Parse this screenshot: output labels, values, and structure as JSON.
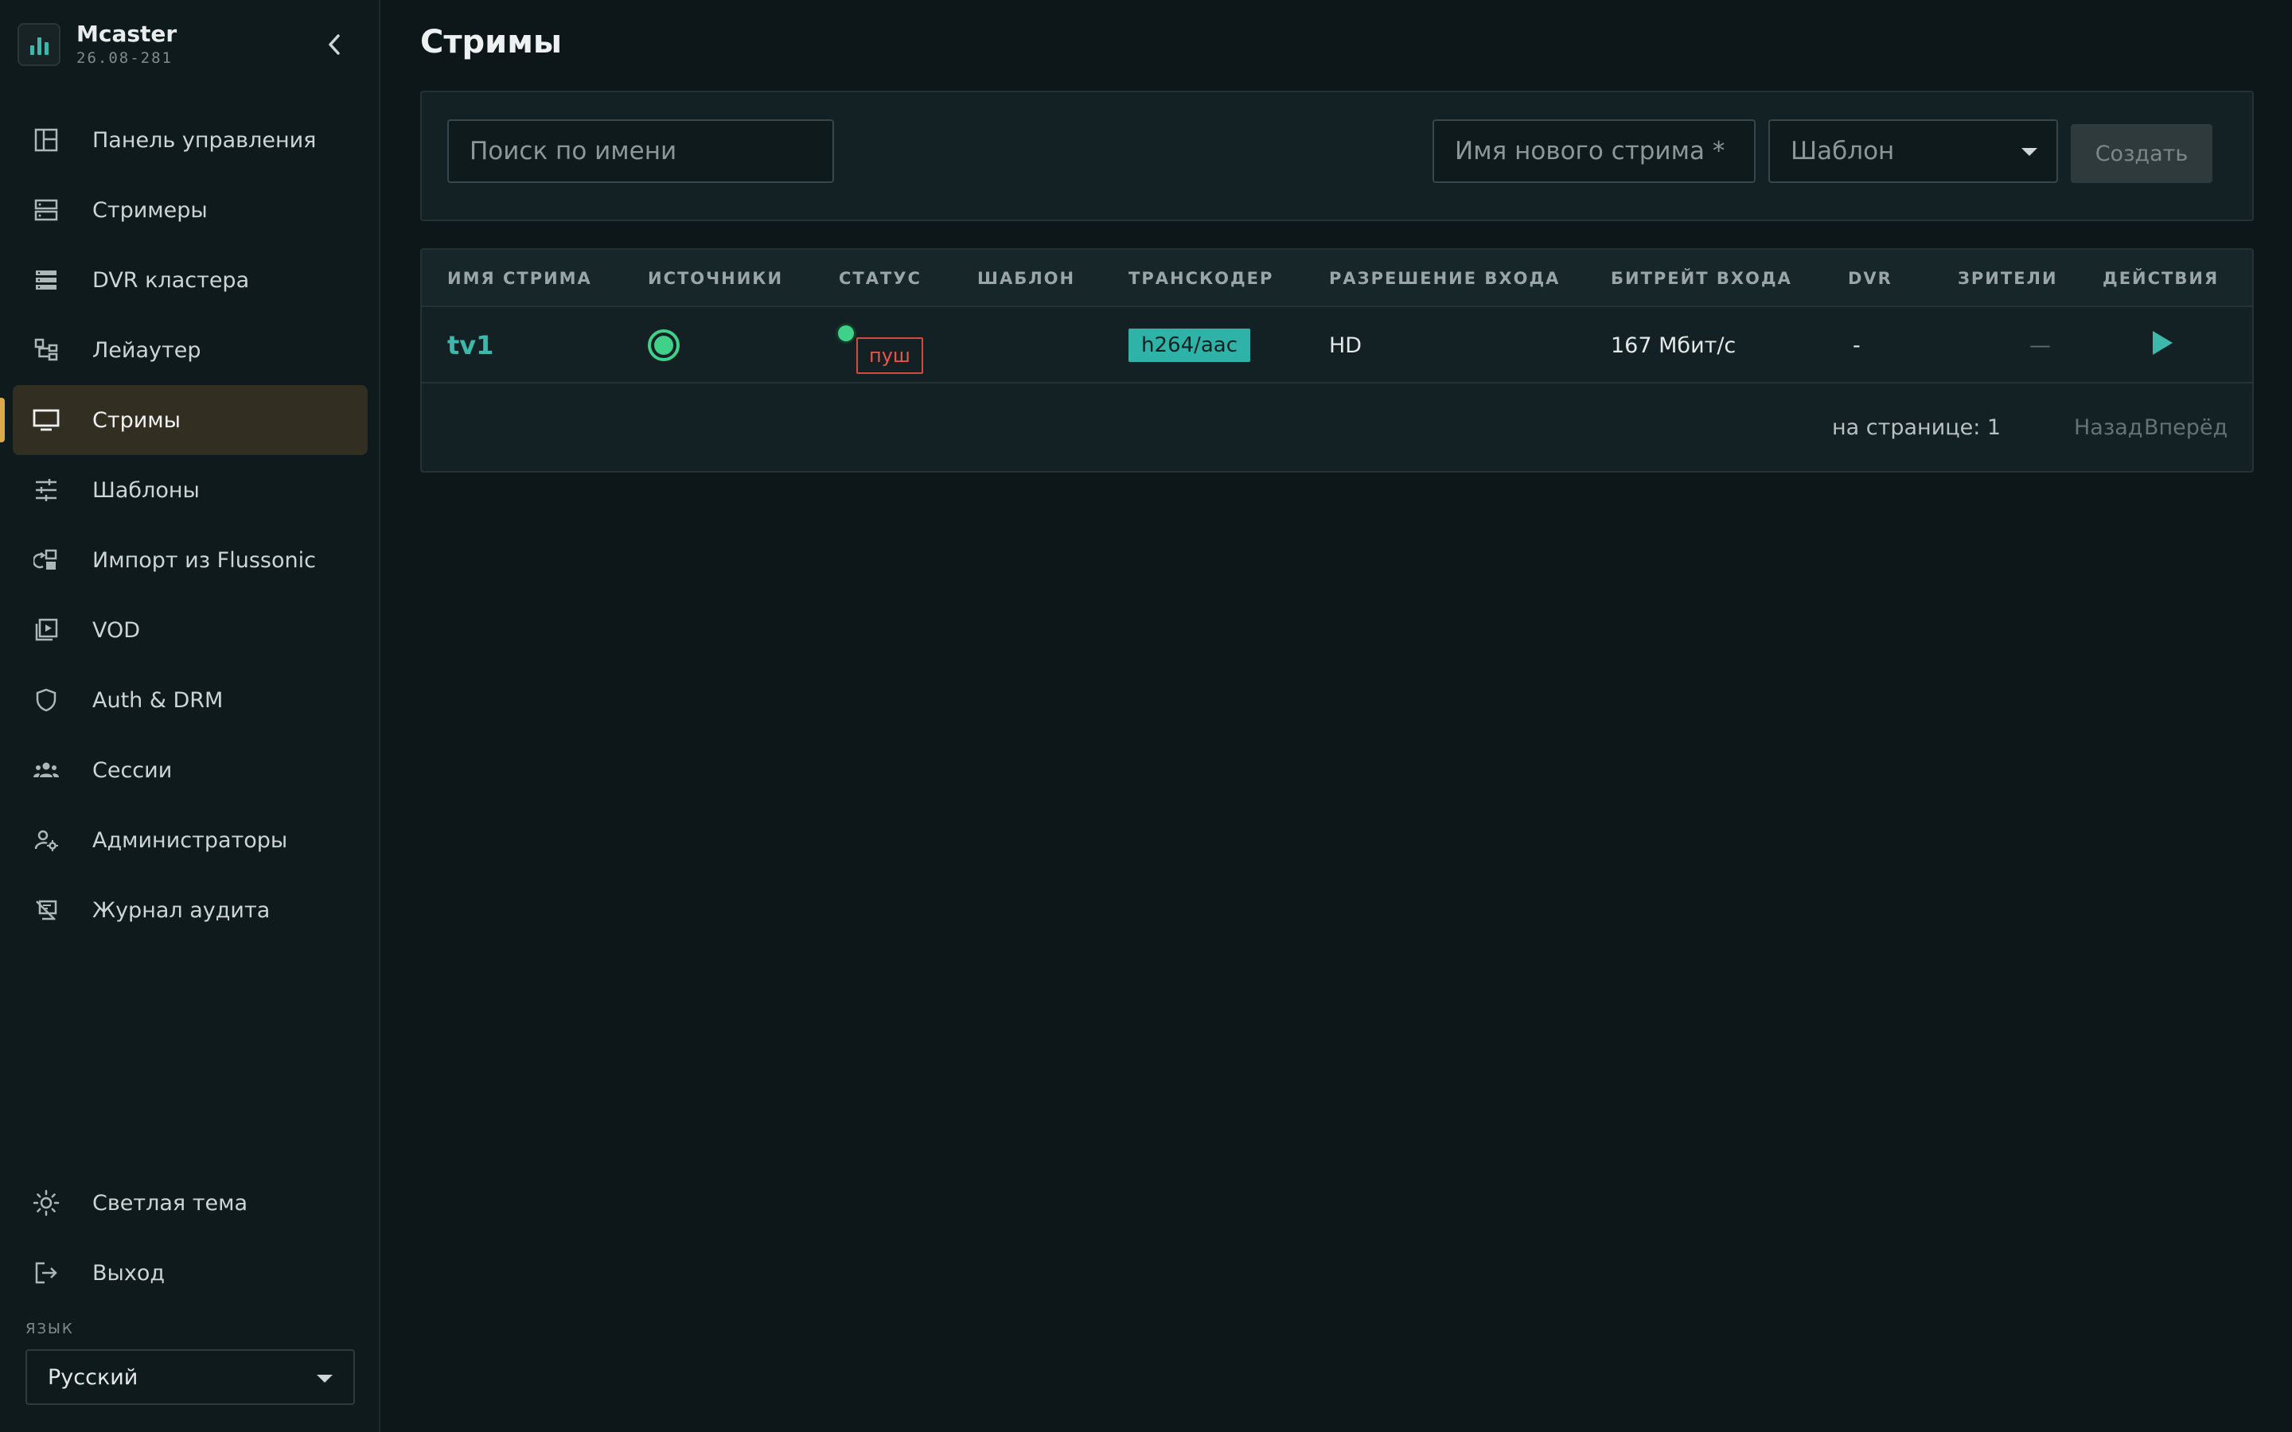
{
  "app": {
    "name": "Mcaster",
    "version": "26.08-281"
  },
  "sidebar": {
    "items": [
      {
        "label": "Панель управления",
        "icon": "dashboard-icon"
      },
      {
        "label": "Стримеры",
        "icon": "server-icon"
      },
      {
        "label": "DVR кластера",
        "icon": "storage-icon"
      },
      {
        "label": "Лейаутер",
        "icon": "layout-icon"
      },
      {
        "label": "Стримы",
        "icon": "monitor-icon",
        "active": true
      },
      {
        "label": "Шаблоны",
        "icon": "sliders-icon"
      },
      {
        "label": "Импорт из Flussonic",
        "icon": "import-icon"
      },
      {
        "label": "VOD",
        "icon": "video-library-icon"
      },
      {
        "label": "Auth & DRM",
        "icon": "shield-icon"
      },
      {
        "label": "Сессии",
        "icon": "users-icon"
      },
      {
        "label": "Администраторы",
        "icon": "user-gear-icon"
      },
      {
        "label": "Журнал аудита",
        "icon": "audit-icon"
      }
    ],
    "bottom": [
      {
        "label": "Светлая тема",
        "icon": "sun-icon"
      },
      {
        "label": "Выход",
        "icon": "logout-icon"
      }
    ],
    "language_label": "ЯЗЫК",
    "language_value": "Русский"
  },
  "main": {
    "title": "Стримы",
    "search_placeholder": "Поиск по имени",
    "new_stream_placeholder": "Имя нового стрима *",
    "template_placeholder": "Шаблон",
    "create_label": "Создать"
  },
  "table": {
    "headers": [
      "ИМЯ СТРИМА",
      "ИСТОЧНИКИ",
      "СТАТУС",
      "ШАБЛОН",
      "ТРАНСКОДЕР",
      "РАЗРЕШЕНИЕ ВХОДА",
      "БИТРЕЙТ ВХОДА",
      "DVR",
      "ЗРИТЕЛИ",
      "ДЕЙСТВИЯ"
    ],
    "rows": [
      {
        "name": "tv1",
        "status": "пуш",
        "template": "",
        "transcoder": "h264/aac",
        "resolution": "HD",
        "bitrate": "167 Мбит/с",
        "dvr": "-",
        "viewers": "—"
      }
    ]
  },
  "pagination": {
    "per_page": "на странице: 1",
    "prev": "Назад",
    "next": "Вперёд"
  },
  "colors": {
    "accent": "#3fb8ac",
    "active_bg": "#322f22",
    "active_marker": "#d9a94a",
    "status_ok": "#3fd18a",
    "status_push": "#e8564a"
  }
}
